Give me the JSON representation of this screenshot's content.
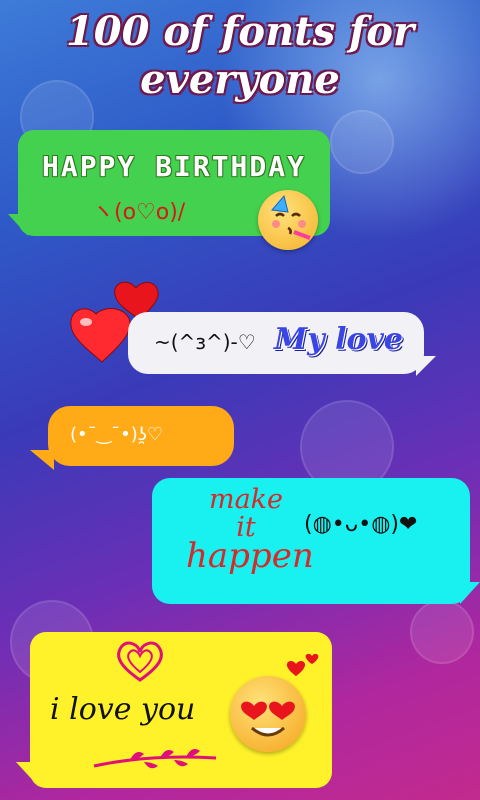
{
  "header": {
    "line1": "100 of fonts for",
    "line2": "everyone"
  },
  "bubbles": [
    {
      "title": "HAPPY BIRTHDAY",
      "kaomoji": "ヽ(o♡o)/",
      "emoji": "party-face-icon",
      "color": "#44d14f"
    },
    {
      "kaomoji": "~(^з^)-♡",
      "title": "My love",
      "emoji": "hearts-icon",
      "color": "#f1f1f6"
    },
    {
      "kaomoji": "(•¯‿¯•)ʖ̯♡",
      "color": "#ffaa16"
    },
    {
      "words": [
        "make",
        "it",
        "happen"
      ],
      "kaomoji": "(◍•ᴗ•◍)❤",
      "color": "#19f0f0"
    },
    {
      "text": "i love you",
      "emoji": "heart-eyes-face-icon",
      "color": "#fff22a"
    }
  ],
  "colors": {
    "accent_red": "#d81818",
    "love_blue": "#3a45e6"
  }
}
